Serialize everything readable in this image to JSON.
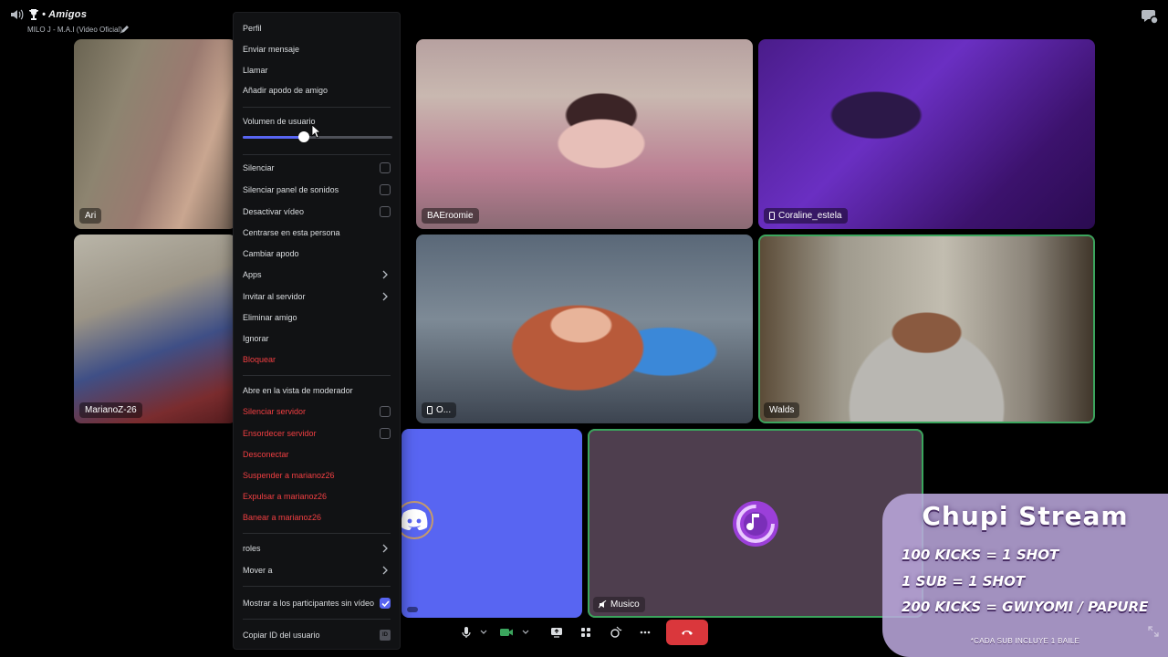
{
  "header": {
    "channel_title": "• Amigos",
    "activity": "MILO J - M.A.I (Video Oficial)"
  },
  "tiles": [
    {
      "name": "Ari"
    },
    {
      "name": "BAEroomie"
    },
    {
      "name": "Coraline_estela"
    },
    {
      "name": "MarianoZ-26"
    },
    {
      "name": "O..."
    },
    {
      "name": "Walds"
    },
    {
      "name": ""
    },
    {
      "name": "Musico"
    }
  ],
  "menu": {
    "items": [
      {
        "label": "Perfil"
      },
      {
        "label": "Enviar mensaje"
      },
      {
        "label": "Llamar"
      },
      {
        "label": "Añadir apodo de amigo"
      }
    ],
    "volume": {
      "label": "Volumen de usuario",
      "value_percent": 41
    },
    "toggles": [
      {
        "label": "Silenciar",
        "checked": false
      },
      {
        "label": "Silenciar panel de sonidos",
        "checked": false
      },
      {
        "label": "Desactivar vídeo",
        "checked": false
      }
    ],
    "actions": [
      {
        "label": "Centrarse en esta persona"
      },
      {
        "label": "Cambiar apodo"
      },
      {
        "label": "Apps"
      },
      {
        "label": "Invitar al servidor"
      },
      {
        "label": "Eliminar amigo"
      },
      {
        "label": "Ignorar"
      },
      {
        "label": "Bloquear"
      }
    ],
    "moderator": [
      {
        "label": "Abre en la vista de moderador"
      },
      {
        "label": "Silenciar servidor",
        "checked": false
      },
      {
        "label": "Ensordecer servidor",
        "checked": false
      },
      {
        "label": "Desconectar"
      },
      {
        "label": "Suspender a marianoz26"
      },
      {
        "label": "Expulsar a marianoz26"
      },
      {
        "label": "Banear a marianoz26"
      }
    ],
    "extra": [
      {
        "label": "roles"
      },
      {
        "label": "Mover a"
      }
    ],
    "show_no_video": {
      "label": "Mostrar a los participantes sin vídeo",
      "checked": true
    },
    "copy_id": {
      "label": "Copiar ID del usuario",
      "badge": "ID"
    }
  },
  "overlay": {
    "title": "Chupi Stream",
    "lines": [
      "100 KICKS = 1 SHOT",
      "1 SUB = 1 SHOT",
      "200 KICKS = GWIYOMI / PAPURE"
    ],
    "note": "*CADA SUB INCLUYE 1 BAILE"
  },
  "colors": {
    "blurple": "#5865f2",
    "danger": "#f23f42",
    "speaking": "#3ba55d",
    "hangup": "#da373c"
  }
}
